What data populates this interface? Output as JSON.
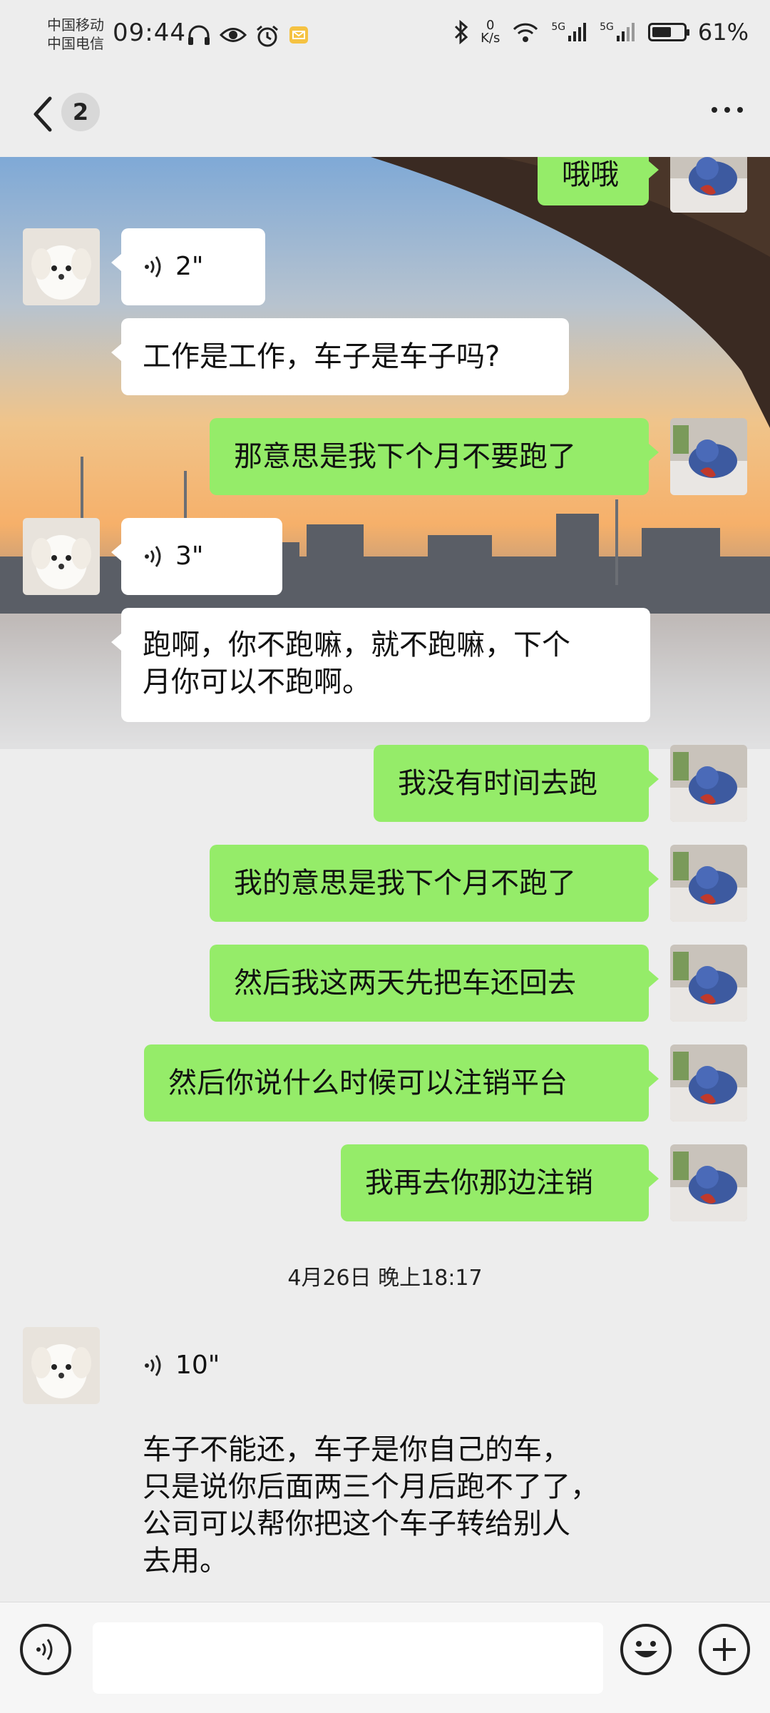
{
  "status_bar": {
    "carrier_1": "中国移动",
    "carrier_2": "中国电信",
    "time": "09:44",
    "net_speed_value": "0",
    "net_speed_unit": "K/s",
    "signal_1_label": "5G",
    "signal_2_label": "5G",
    "battery_text": "61%",
    "battery_level": 0.61
  },
  "header": {
    "unread_count": "2"
  },
  "messages": [
    {
      "side": "out",
      "type": "text",
      "text": "哦哦"
    },
    {
      "side": "in",
      "type": "voice",
      "duration": "2\""
    },
    {
      "side": "in",
      "type": "text",
      "text": "工作是工作，车子是车子吗?"
    },
    {
      "side": "out",
      "type": "text",
      "text": "那意思是我下个月不要跑了"
    },
    {
      "side": "in",
      "type": "voice",
      "duration": "3\""
    },
    {
      "side": "in",
      "type": "text",
      "text_line1": "跑啊，你不跑嘛，就不跑嘛，下个",
      "text_line2": "月你可以不跑啊。"
    },
    {
      "side": "out",
      "type": "text",
      "text": "我没有时间去跑"
    },
    {
      "side": "out",
      "type": "text",
      "text": "我的意思是我下个月不跑了"
    },
    {
      "side": "out",
      "type": "text",
      "text": "然后我这两天先把车还回去"
    },
    {
      "side": "out",
      "type": "text",
      "text": "然后你说什么时候可以注销平台"
    },
    {
      "side": "out",
      "type": "text",
      "text": "我再去你那边注销"
    },
    {
      "side": "in",
      "type": "voice",
      "duration": "10\""
    },
    {
      "side": "in",
      "type": "text",
      "lines": [
        "车子不能还，车子是你自己的车，",
        "只是说你后面两三个月后跑不了了，",
        "公司可以帮你把这个车子转给别人",
        "去用。"
      ]
    }
  ],
  "timestamp": "4月26日 晚上18:17",
  "input_bar": {
    "value": ""
  },
  "colors": {
    "outgoing_bubble": "#95ec69",
    "incoming_bubble": "#ffffff",
    "background": "#ededed"
  }
}
